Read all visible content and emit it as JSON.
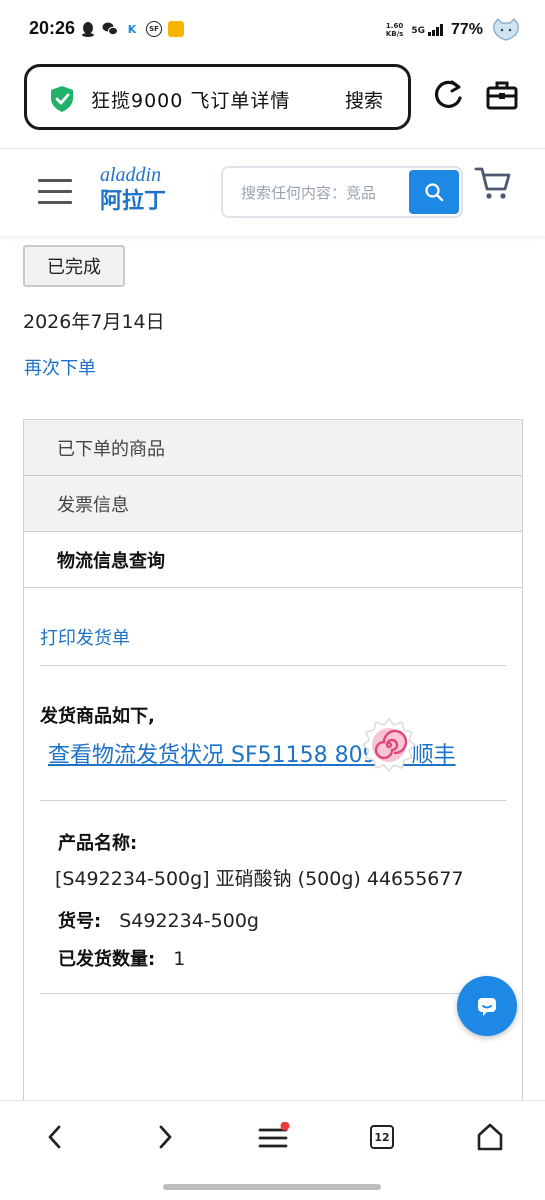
{
  "status_bar": {
    "time": "20:26",
    "net_speed_value": "1.60",
    "net_speed_unit": "KB/s",
    "network": "5G",
    "battery": "77%",
    "notification_icons": [
      "qq-icon",
      "wechat-icon",
      "k-app-icon",
      "sf-icon",
      "gold-app-icon"
    ]
  },
  "browser": {
    "url_text": "狂揽9000 飞订单详情",
    "search_label": "搜索"
  },
  "site_header": {
    "logo_en": "aladdin",
    "logo_cn": "阿拉丁",
    "search_placeholder": "搜索任何内容：竞品",
    "accent_color": "#1e88e5"
  },
  "order": {
    "status": "已完成",
    "date": "2026年7月14日",
    "reorder_label": "再次下单"
  },
  "accordion": {
    "sections": [
      {
        "label": "已下单的商品",
        "active": false
      },
      {
        "label": "发票信息",
        "active": false
      },
      {
        "label": "物流信息查询",
        "active": true
      }
    ],
    "print_label": "打印发货单",
    "shipped_title": "发货商品如下,",
    "tracking_link": "查看物流发货状况 SF51158    80982 顺丰",
    "product": {
      "name_label": "产品名称:",
      "name": "[S492234-500g] 亚硝酸钠 (500g) 44655677",
      "sku_label": "货号:",
      "sku": "S492234-500g",
      "qty_label": "已发货数量:",
      "qty": "1"
    }
  },
  "bottom_nav": {
    "tab_count": "12"
  }
}
